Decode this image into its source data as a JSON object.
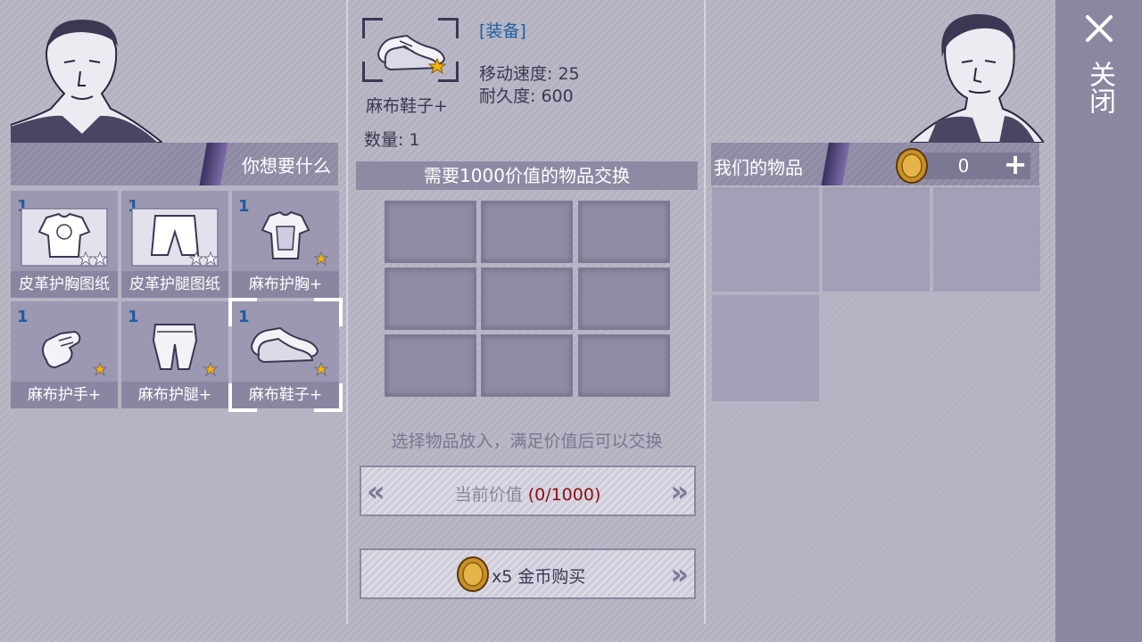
{
  "left": {
    "header": "你想要什么",
    "items": [
      {
        "qty": "1",
        "name": "皮革护胸图纸",
        "icon": "leather-chestplate-blueprint-icon",
        "stars": 2,
        "star_color": "#ffffff"
      },
      {
        "qty": "1",
        "name": "皮革护腿图纸",
        "icon": "leather-leggings-blueprint-icon",
        "stars": 2,
        "star_color": "#ffffff"
      },
      {
        "qty": "1",
        "name": "麻布护胸+",
        "icon": "linen-chestguard-icon",
        "stars": 1,
        "star_color": "#f5b400"
      },
      {
        "qty": "1",
        "name": "麻布护手+",
        "icon": "linen-gloves-icon",
        "stars": 1,
        "star_color": "#f5b400"
      },
      {
        "qty": "1",
        "name": "麻布护腿+",
        "icon": "linen-leggings-icon",
        "stars": 1,
        "star_color": "#f5b400"
      },
      {
        "qty": "1",
        "name": "麻布鞋子+",
        "icon": "linen-shoes-icon",
        "stars": 1,
        "star_color": "#f5b400",
        "selected": true
      }
    ]
  },
  "detail": {
    "category": "[装备]",
    "name": "麻布鞋子+",
    "stat1": "移动速度: 25",
    "stat2": "耐久度: 600",
    "quantity": "数量: 1"
  },
  "trade": {
    "header": "需要1000价值的物品交换",
    "hint": "选择物品放入，满足价值后可以交换",
    "value_label": "当前价值",
    "value": "(0/1000)",
    "buy_amount": "x5",
    "buy_label": "金币购买"
  },
  "right": {
    "header": "我们的物品",
    "coins": "0"
  },
  "close_label": "关闭",
  "colors": {
    "accent_blue": "#1e5ea0",
    "value_red": "#8b1010",
    "star_gold": "#f5b400"
  }
}
